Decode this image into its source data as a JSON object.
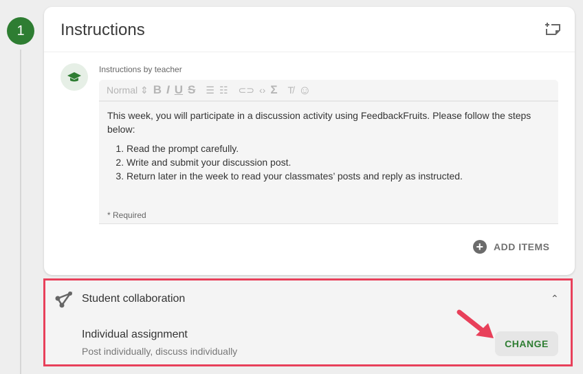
{
  "step_number": "1",
  "card": {
    "title": "Instructions",
    "by_label": "Instructions by teacher"
  },
  "toolbar": {
    "format": "Normal",
    "bold": "B",
    "italic": "I",
    "underline": "U",
    "strike": "S"
  },
  "content": {
    "intro": "This week, you will participate in a discussion activity using FeedbackFruits. Please follow the steps below:",
    "steps": [
      "Read the prompt carefully.",
      "Write and submit your discussion post.",
      "Return later in the week to read your classmates’ posts and reply as instructed."
    ],
    "required": "* Required"
  },
  "add_items_label": "ADD ITEMS",
  "collaboration": {
    "title": "Student collaboration",
    "assignment": "Individual assignment",
    "description": "Post individually, discuss individually",
    "change_label": "CHANGE"
  },
  "colors": {
    "accent": "#2e7d32",
    "highlight": "#e8405a"
  }
}
